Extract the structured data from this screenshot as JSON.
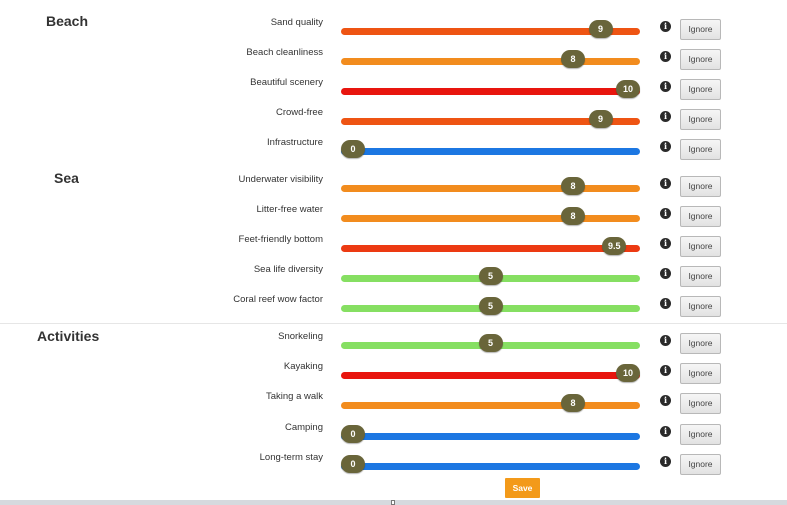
{
  "sections": [
    {
      "title": "Beach"
    },
    {
      "title": "Sea"
    },
    {
      "title": "Activities"
    }
  ],
  "rows": [
    {
      "label": "Sand quality",
      "value": "9",
      "level": 0.9,
      "color": "#ee5413"
    },
    {
      "label": "Beach cleanliness",
      "value": "8",
      "level": 0.8,
      "color": "#f28c1e"
    },
    {
      "label": "Beautiful scenery",
      "value": "10",
      "level": 1.0,
      "color": "#e8150e"
    },
    {
      "label": "Crowd-free",
      "value": "9",
      "level": 0.9,
      "color": "#ee5413"
    },
    {
      "label": "Infrastructure",
      "value": "0",
      "level": 0.0,
      "color": "#1c77e2"
    },
    {
      "label": "Underwater visibility",
      "value": "8",
      "level": 0.8,
      "color": "#f28c1e"
    },
    {
      "label": "Litter-free water",
      "value": "8",
      "level": 0.8,
      "color": "#f28c1e"
    },
    {
      "label": "Feet-friendly bottom",
      "value": "9.5",
      "level": 0.95,
      "color": "#ec3a12"
    },
    {
      "label": "Sea life diversity",
      "value": "5",
      "level": 0.5,
      "color": "#86df62"
    },
    {
      "label": "Coral reef wow factor",
      "value": "5",
      "level": 0.5,
      "color": "#86df62"
    },
    {
      "label": "Snorkeling",
      "value": "5",
      "level": 0.5,
      "color": "#86df62"
    },
    {
      "label": "Kayaking",
      "value": "10",
      "level": 1.0,
      "color": "#e8150e"
    },
    {
      "label": "Taking a walk",
      "value": "8",
      "level": 0.8,
      "color": "#f28c1e"
    },
    {
      "label": "Camping",
      "value": "0",
      "level": 0.0,
      "color": "#1c77e2"
    },
    {
      "label": "Long-term stay",
      "value": "0",
      "level": 0.0,
      "color": "#1c77e2"
    }
  ],
  "info_glyph": "i",
  "ignore_label": "Ignore",
  "save_label": "Save"
}
